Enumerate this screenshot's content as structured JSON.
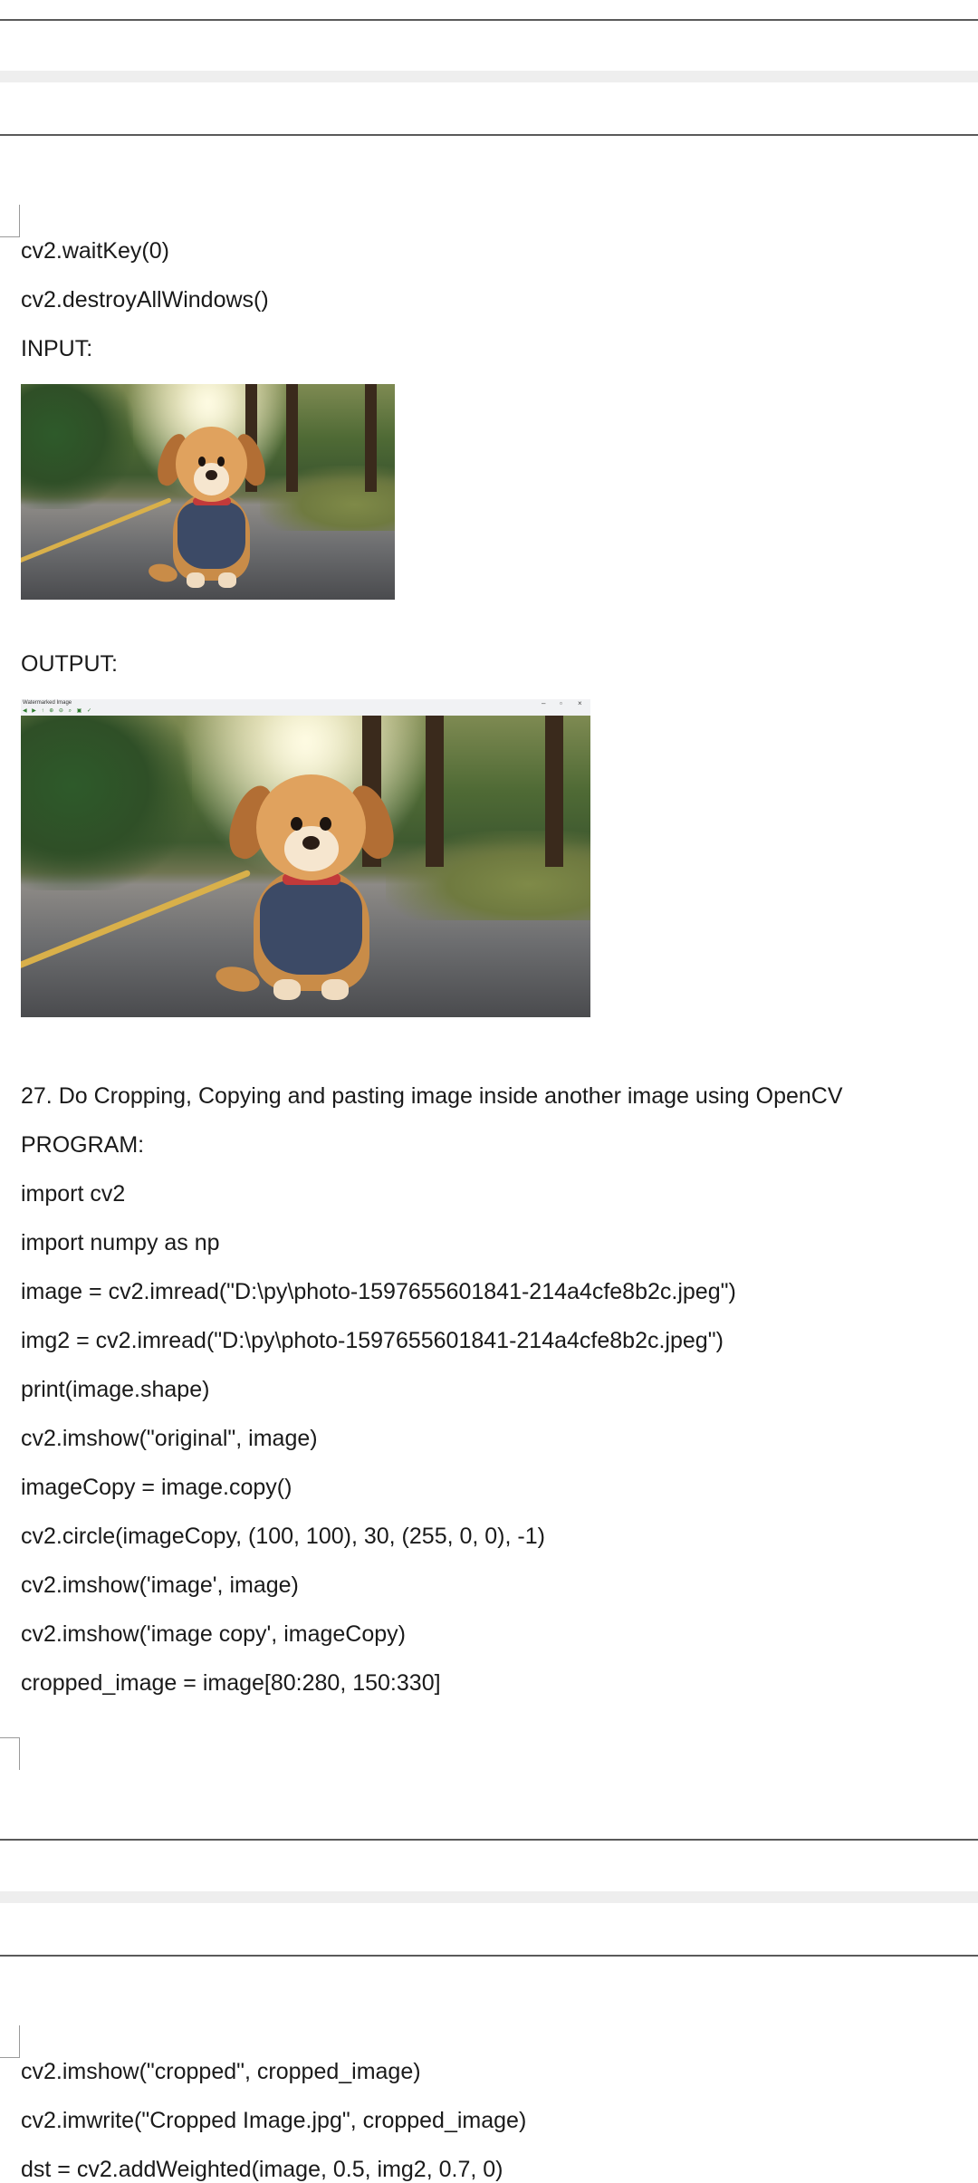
{
  "page1_bottom_lines": {
    "l1": "cv2.waitKey(0)",
    "l2": "cv2.destroyAllWindows()",
    "l3": "INPUT:",
    "l4": "OUTPUT:"
  },
  "output_window": {
    "title": "Watermarked Image",
    "minimize": "–",
    "maximize": "▫",
    "close": "×"
  },
  "section27": {
    "heading": "27. Do Cropping, Copying and pasting image inside another image using OpenCV",
    "program_label": "PROGRAM:",
    "code": [
      "import cv2",
      "import numpy as np",
      "image = cv2.imread(\"D:\\py\\photo-1597655601841-214a4cfe8b2c.jpeg\")",
      "img2 = cv2.imread(\"D:\\py\\photo-1597655601841-214a4cfe8b2c.jpeg\")",
      "print(image.shape)",
      "cv2.imshow(\"original\", image)",
      "imageCopy = image.copy()",
      "cv2.circle(imageCopy, (100, 100), 30, (255, 0, 0), -1)",
      "cv2.imshow('image', image)",
      "cv2.imshow('image copy', imageCopy)",
      "cropped_image = image[80:280, 150:330]"
    ]
  },
  "next_page_lines": [
    "cv2.imshow(\"cropped\", cropped_image)",
    "cv2.imwrite(\"Cropped Image.jpg\", cropped_image)",
    "dst = cv2.addWeighted(image, 0.5, img2, 0.7, 0)"
  ]
}
